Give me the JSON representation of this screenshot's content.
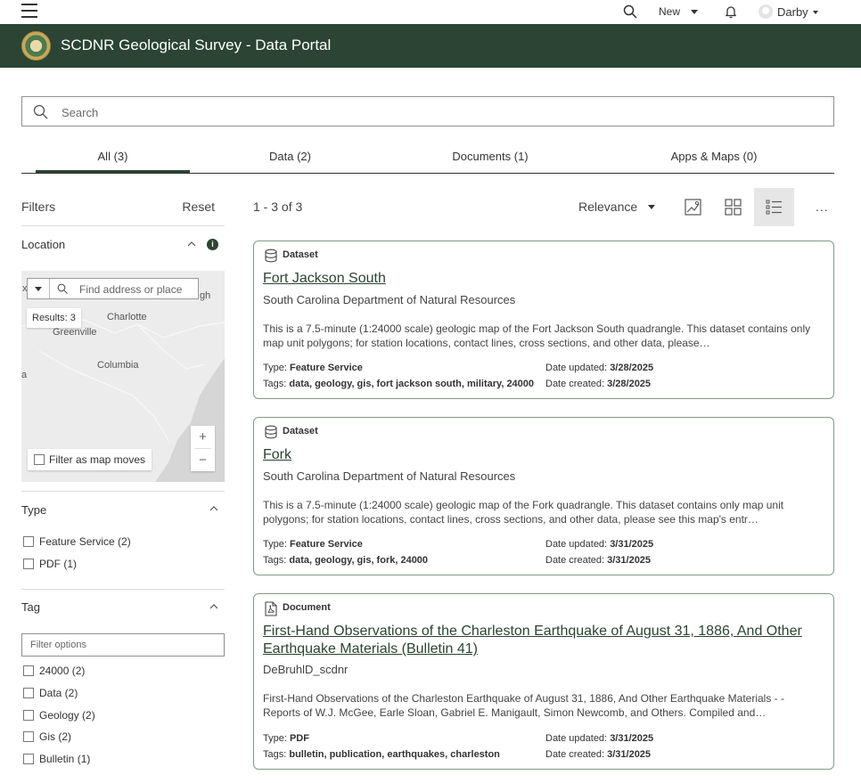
{
  "topbar": {
    "new_label": "New",
    "user_name": "Darby"
  },
  "header": {
    "title": "SCDNR Geological Survey - Data Portal"
  },
  "search": {
    "placeholder": "Search"
  },
  "tabs": [
    {
      "label": "All (3)"
    },
    {
      "label": "Data (2)"
    },
    {
      "label": "Documents (1)"
    },
    {
      "label": "Apps & Maps (0)"
    }
  ],
  "filters": {
    "title": "Filters",
    "reset": "Reset",
    "location": {
      "label": "Location",
      "map_search_placeholder": "Find address or place",
      "results": "Results: 3",
      "places": [
        "Charlotte",
        "Greenville",
        "Columbia",
        "gh",
        "x",
        "a"
      ],
      "zoom_in": "+",
      "zoom_out": "−",
      "filter_as_map_moves": "Filter as map moves"
    },
    "type": {
      "label": "Type",
      "options": [
        "Feature Service (2)",
        "PDF (1)"
      ]
    },
    "tag": {
      "label": "Tag",
      "filter_placeholder": "Filter options",
      "options": [
        "24000 (2)",
        "Data (2)",
        "Geology (2)",
        "Gis (2)",
        "Bulletin (1)"
      ]
    }
  },
  "results": {
    "count": "1 - 3 of 3",
    "sort": "Relevance",
    "more": "...",
    "items": [
      {
        "type": "Dataset",
        "title": "Fort Jackson South",
        "owner": "South Carolina Department of Natural Resources",
        "description": "This is a 7.5-minute (1:24000 scale) geologic map of the Fort Jackson South quadrangle. This dataset contains only map unit polygons; for station locations, contact lines, cross sections, and other data, please…",
        "type_label": "Type:",
        "type_value": "Feature Service",
        "tags_label": "Tags:",
        "tags_value": "data, geology, gis, fort jackson south, military, 24000",
        "updated_label": "Date updated:",
        "updated_value": "3/28/2025",
        "created_label": "Date created:",
        "created_value": "3/28/2025"
      },
      {
        "type": "Dataset",
        "title": "Fork",
        "owner": "South Carolina Department of Natural Resources",
        "description": "This is a 7.5-minute (1:24000 scale) geologic map of the Fork quadrangle. This dataset contains only map unit polygons; for station locations, contact lines, cross sections, and other data, please see this map's entr…",
        "type_label": "Type:",
        "type_value": "Feature Service",
        "tags_label": "Tags:",
        "tags_value": "data, geology, gis, fork, 24000",
        "updated_label": "Date updated:",
        "updated_value": "3/31/2025",
        "created_label": "Date created:",
        "created_value": "3/31/2025"
      },
      {
        "type": "Document",
        "title": "First-Hand Observations of the Charleston Earthquake of August 31, 1886, And Other Earthquake Materials (Bulletin 41)",
        "owner": "DeBruhlD_scdnr",
        "description": "First-Hand Observations of the Charleston Earthquake of August 31, 1886, And Other Earthquake Materials - - Reports of W.J. McGee, Earle Sloan, Gabriel E. Manigault, Simon Newcomb, and Others. Compiled and…",
        "type_label": "Type:",
        "type_value": "PDF",
        "tags_label": "Tags:",
        "tags_value": "bulletin, publication, earthquakes, charleston",
        "updated_label": "Date updated:",
        "updated_value": "3/31/2025",
        "created_label": "Date created:",
        "created_value": "3/31/2025"
      }
    ]
  }
}
